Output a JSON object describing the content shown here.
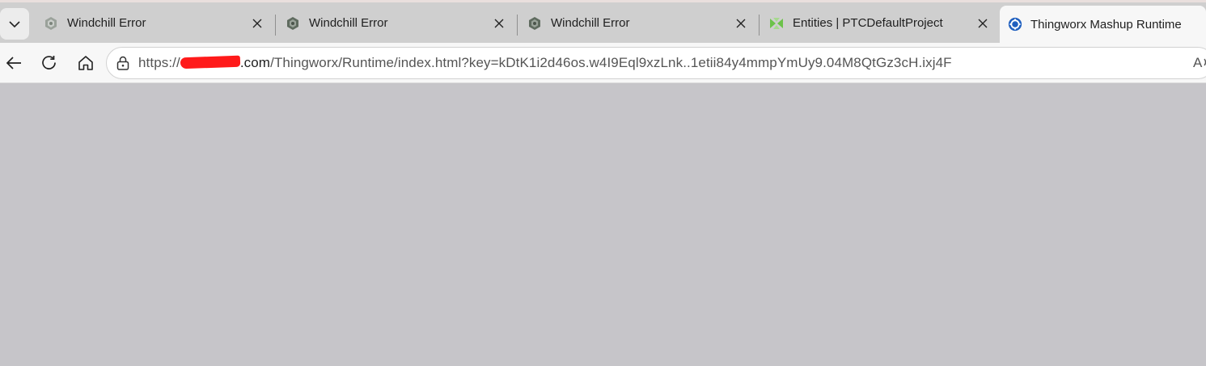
{
  "tabs": [
    {
      "title": "Windchill Error",
      "icon": "windchill-logo-icon",
      "active": false
    },
    {
      "title": "Windchill Error",
      "icon": "windchill-logo-icon",
      "active": false
    },
    {
      "title": "Windchill Error",
      "icon": "windchill-logo-icon",
      "active": false
    },
    {
      "title": "Entities | PTCDefaultProject",
      "icon": "thingworx-entities-icon",
      "active": false
    },
    {
      "title": "Thingworx Mashup Runtime",
      "icon": "thingworx-gear-icon",
      "active": true
    }
  ],
  "address": {
    "scheme": "https://",
    "host_suffix": ".com",
    "path": "/Thingworx/Runtime/index.html?key=kDtK1i2d46os.w4I9Eql9xzLnk..1etii84y4mmpYmUy9.04M8QtGz3cH.ixj4F"
  },
  "colors": {
    "content_background": "#c6c5c9",
    "redaction": "#ff1a1a",
    "thingworx_blue": "#1f5fbf"
  }
}
